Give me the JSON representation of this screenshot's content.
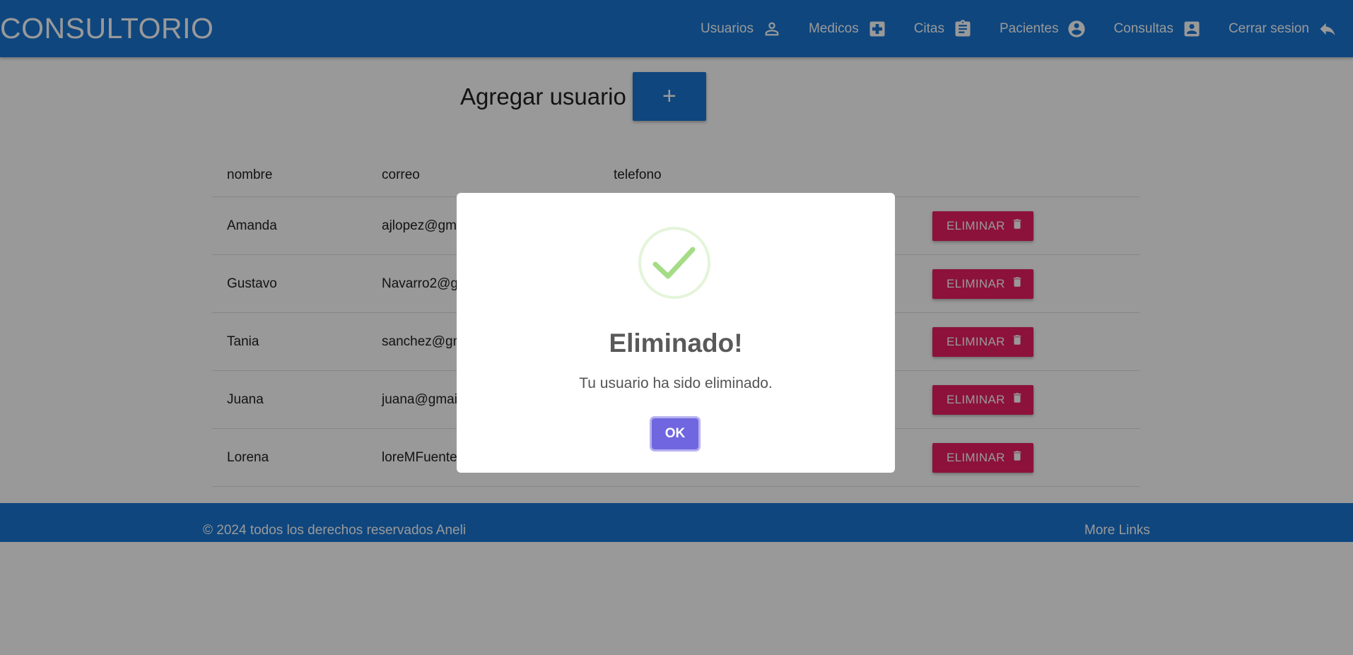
{
  "brand": "CONSULTORIO",
  "nav": {
    "usuarios": "Usuarios",
    "medicos": "Medicos",
    "citas": "Citas",
    "pacientes": "Pacientes",
    "consultas": "Consultas",
    "cerrar": "Cerrar sesion"
  },
  "page": {
    "add_title": "Agregar usuario",
    "add_button": "+"
  },
  "table": {
    "headers": [
      "nombre",
      "correo",
      "telefono"
    ],
    "delete_label": "ELIMINAR",
    "rows": [
      {
        "nombre": "Amanda",
        "correo": "ajlopez@gm"
      },
      {
        "nombre": "Gustavo",
        "correo": "Navarro2@g"
      },
      {
        "nombre": "Tania",
        "correo": "sanchez@gn"
      },
      {
        "nombre": "Juana",
        "correo": "juana@gmai"
      },
      {
        "nombre": "Lorena",
        "correo": "loreMFuente"
      }
    ]
  },
  "footer": {
    "copyright": "© 2024 todos los derechos reservados Aneli",
    "links": "More Links"
  },
  "modal": {
    "title": "Eliminado!",
    "text": "Tu usuario ha sido eliminado.",
    "ok": "OK",
    "icon": "success-check-icon"
  },
  "colors": {
    "primary": "#1976d2",
    "delete": "#e91e63",
    "confirm": "#7066e0",
    "success": "#a5dc86"
  }
}
